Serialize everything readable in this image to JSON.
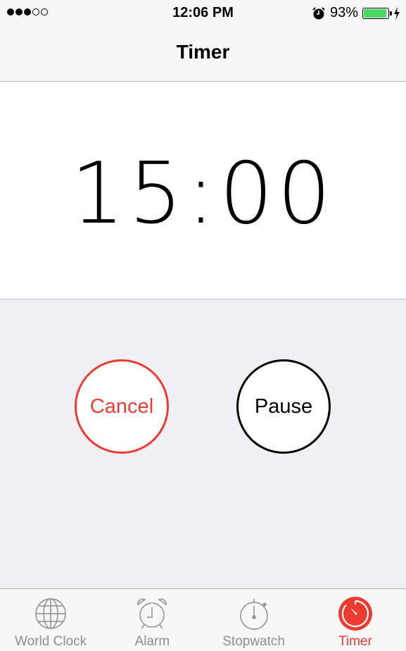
{
  "status_bar": {
    "signal_bars": 3,
    "signal_total": 5,
    "time": "12:06 PM",
    "alarm_icon": "alarm-clock-icon",
    "battery_percent_label": "93%",
    "battery_level": 0.93,
    "charging_icon": "lightning-bolt-icon"
  },
  "nav": {
    "title": "Timer"
  },
  "timer": {
    "display": "15:00"
  },
  "buttons": {
    "cancel_label": "Cancel",
    "pause_label": "Pause"
  },
  "colors": {
    "accent": "#ee3b32",
    "battery": "#4cd964",
    "inactive_tab": "#8e8e93"
  },
  "tabs": [
    {
      "label": "World Clock",
      "icon": "globe-icon",
      "active": false
    },
    {
      "label": "Alarm",
      "icon": "alarm-clock-icon",
      "active": false
    },
    {
      "label": "Stopwatch",
      "icon": "stopwatch-icon",
      "active": false
    },
    {
      "label": "Timer",
      "icon": "timer-icon",
      "active": true
    }
  ]
}
